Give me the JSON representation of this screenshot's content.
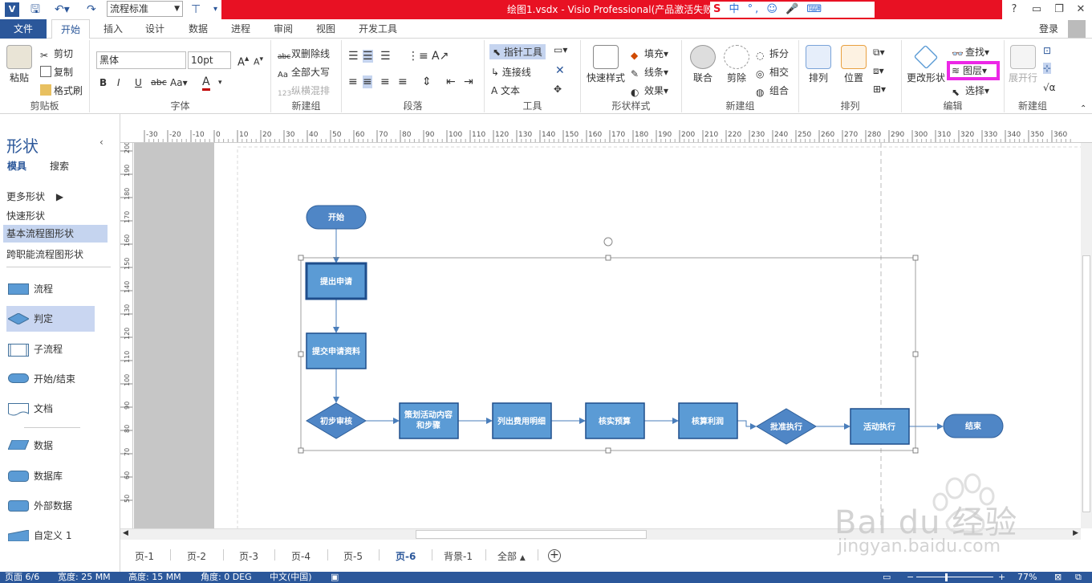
{
  "app": {
    "title": "绘图1.vsdx - Visio Professional(产品激活失败)",
    "style_combo": "流程标准",
    "ime_text": "中 °, ☺ 🎤 ⌨",
    "colors": {
      "brand": "#2b579a",
      "titlebar": "#e81123",
      "highlight": "#ec27e6",
      "shape_fill": "#5b9bd5",
      "shape_stroke": "#1f4e8c"
    }
  },
  "tabs": [
    "文件",
    "开始",
    "插入",
    "设计",
    "数据",
    "进程",
    "审阅",
    "视图",
    "开发工具"
  ],
  "login": "登录",
  "ribbon": {
    "clipboard": {
      "paste": "粘贴",
      "cut": "剪切",
      "copy": "复制",
      "format_painter": "格式刷",
      "label": "剪贴板"
    },
    "font": {
      "family": "黑体",
      "size": "10pt",
      "label": "字体"
    },
    "newgroup": {
      "double_strike": "双删除线",
      "all_caps": "全部大写",
      "vertical_mix": "纵横混排",
      "label": "新建组"
    },
    "paragraph": {
      "label": "段落"
    },
    "tools": {
      "pointer": "指针工具",
      "connector": "连接线",
      "text": "文本",
      "label": "工具"
    },
    "shape_styles": {
      "quick_styles": "快速样式",
      "fill": "填充",
      "line": "线条",
      "effects": "效果",
      "label": "形状样式"
    },
    "newgroup2": {
      "union": "联合",
      "fragment": "剪除",
      "split": "拆分",
      "intersect": "相交",
      "combine": "组合",
      "label": "新建组"
    },
    "arrange": {
      "arrange": "排列",
      "position": "位置",
      "label": "排列"
    },
    "edit": {
      "change_shape": "更改形状",
      "find": "查找",
      "layers": "图层",
      "select": "选择",
      "label": "编辑"
    },
    "newgroup3": {
      "expand_row": "展开行",
      "label": "新建组"
    }
  },
  "shapes_panel": {
    "title": "形状",
    "tab_stencils": "模具",
    "tab_search": "搜索",
    "stencils": [
      "更多形状",
      "快速形状",
      "基本流程图形状",
      "跨职能流程图形状"
    ],
    "shapes": [
      "流程",
      "判定",
      "子流程",
      "开始/结束",
      "文档",
      "数据",
      "数据库",
      "外部数据",
      "自定义 1"
    ]
  },
  "ruler": {
    "h": [
      "-30",
      "-20",
      "-10",
      "0",
      "10",
      "20",
      "30",
      "40",
      "50",
      "60",
      "70",
      "80",
      "90",
      "100",
      "110",
      "120",
      "130",
      "140",
      "150",
      "160",
      "170",
      "180",
      "190",
      "200",
      "210",
      "220",
      "230",
      "240",
      "250",
      "260",
      "270",
      "280",
      "290",
      "300",
      "310",
      "320",
      "330",
      "340",
      "350",
      "360"
    ],
    "v": [
      "200",
      "190",
      "180",
      "170",
      "160",
      "150",
      "140",
      "130",
      "120",
      "110",
      "100",
      "90",
      "80",
      "70",
      "60",
      "50"
    ]
  },
  "flow": {
    "start": "开始",
    "submit": "提出申请",
    "materials": "提交申请资料",
    "review": "初步审核",
    "plan_line1": "策划活动内容",
    "plan_line2": "和步骤",
    "costs": "列出费用明细",
    "budget": "核实预算",
    "profit": "核算利润",
    "approve": "批准执行",
    "execute": "活动执行",
    "end": "结束"
  },
  "pages": [
    "页-1",
    "页-2",
    "页-3",
    "页-4",
    "页-5",
    "页-6",
    "背景-1",
    "全部"
  ],
  "active_page": "页-6",
  "status": {
    "page": "页面 6/6",
    "width": "宽度: 25 MM",
    "height": "高度: 15 MM",
    "angle": "角度: 0 DEG",
    "lang": "中文(中国)",
    "zoom": "77%"
  },
  "watermark": {
    "brand": "Bai du 经验",
    "url": "jingyan.baidu.com"
  }
}
